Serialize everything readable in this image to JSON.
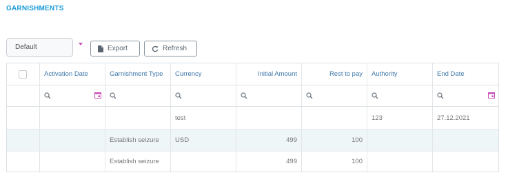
{
  "page": {
    "title": "GARNISHMENTS"
  },
  "toolbar": {
    "preset_value": "Default",
    "export_label": "Export",
    "refresh_label": "Refresh"
  },
  "grid": {
    "columns": [
      "Activation Date",
      "Garnishment Type",
      "Currency",
      "Initial Amount",
      "Rest to pay",
      "Authority",
      "End Date"
    ],
    "rows": [
      {
        "activation_date": "",
        "type": "",
        "currency": "test",
        "initial_amount": "",
        "rest_to_pay": "",
        "authority": "123",
        "end_date": "27.12.2021"
      },
      {
        "activation_date": "",
        "type": "Establish seizure",
        "currency": "USD",
        "initial_amount": "499",
        "rest_to_pay": "100",
        "authority": "",
        "end_date": ""
      },
      {
        "activation_date": "",
        "type": "Establish seizure",
        "currency": "",
        "initial_amount": "499",
        "rest_to_pay": "100",
        "authority": "",
        "end_date": ""
      }
    ]
  },
  "colors": {
    "title": "#1a9bd7",
    "header_text": "#3f77a8",
    "accent": "#c84fb7",
    "selected_row": "#eef6f8"
  }
}
